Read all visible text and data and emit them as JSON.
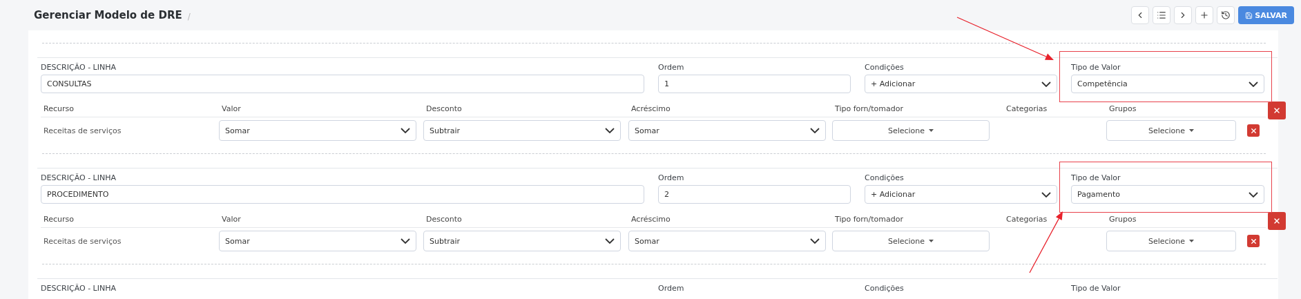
{
  "header": {
    "title": "Gerenciar Modelo de DRE",
    "separator": "/"
  },
  "toolbar": {
    "save_label": "SALVAR"
  },
  "sections": [
    {
      "description_label": "DESCRIÇÃO - LINHA",
      "description": "CONSULTAS",
      "order_label": "Ordem",
      "order": "1",
      "conditions_label": "Condições",
      "conditions": "+ Adicionar",
      "value_type_label": "Tipo de Valor",
      "value_type": "Competência",
      "highlighted": true,
      "arrow_below": false,
      "columns": [
        "Recurso",
        "Valor",
        "Desconto",
        "Acréscimo",
        "Tipo forn/tomador",
        "Categorias",
        "Grupos"
      ],
      "rows": [
        {
          "resource": "Receitas de serviços",
          "valor": "Somar",
          "desconto": "Subtrair",
          "acrescimo": "Somar",
          "tipo_forn": "Selecione",
          "grupos": "Selecione"
        }
      ]
    },
    {
      "description_label": "DESCRIÇÃO - LINHA",
      "description": "PROCEDIMENTO",
      "order_label": "Ordem",
      "order": "2",
      "conditions_label": "Condições",
      "conditions": "+ Adicionar",
      "value_type_label": "Tipo de Valor",
      "value_type": "Pagamento",
      "highlighted": true,
      "arrow_below": true,
      "columns": [
        "Recurso",
        "Valor",
        "Desconto",
        "Acréscimo",
        "Tipo forn/tomador",
        "Categorias",
        "Grupos"
      ],
      "rows": [
        {
          "resource": "Receitas de serviços",
          "valor": "Somar",
          "desconto": "Subtrair",
          "acrescimo": "Somar",
          "tipo_forn": "Selecione",
          "grupos": "Selecione"
        }
      ]
    },
    {
      "description_label": "DESCRIÇÃO - LINHA",
      "order_label": "Ordem",
      "conditions_label": "Condições",
      "value_type_label": "Tipo de Valor",
      "highlighted": false
    }
  ]
}
